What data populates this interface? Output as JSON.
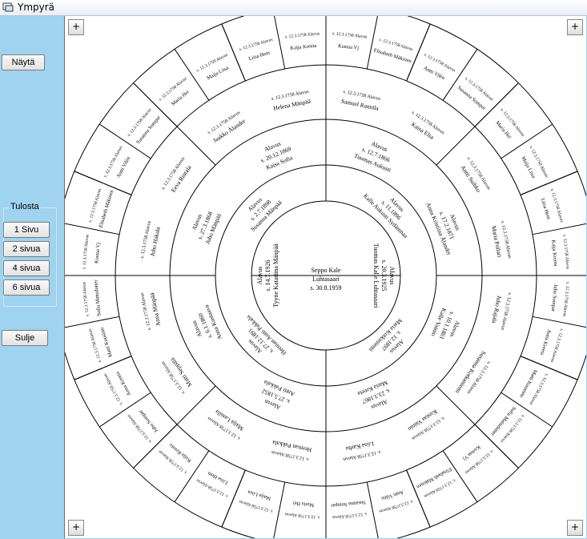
{
  "window": {
    "title": "Ympyrä"
  },
  "left_panel": {
    "show_button": "Näytä",
    "print_group": {
      "label": "Tulosta",
      "buttons": [
        "1 Sivu",
        "2 sivua",
        "4 sivua",
        "6 sivua"
      ]
    },
    "close_button": "Sulje"
  },
  "canvas": {
    "corner_buttons": [
      "+",
      "+",
      "+",
      "+"
    ],
    "center_person": {
      "name": "Seppo Kale",
      "surname": "Luhtasaari",
      "birth": "s. 30.8.1959"
    },
    "ring1": [
      "Tuomas Kalle Luhtasaari · s. 20.3.1925 · Alavus",
      "Tyyne Katariina Mänpää · s. 14.7.1926 · Alavus"
    ],
    "ring2": [
      "Kalle Aukusti Sydänmaa · s. 11.1896 · Alavus",
      "Maria Kotkaniemi · s. 12.1897 · Alavus",
      "Herman Antti Pakkala · s. 27.12.1891 · Alavus",
      "Susanna Mänpää · s. 2.7.1898 · Alavus"
    ],
    "ring3": [
      "Tuomas Aukusti · s. 12.7.1866 · Alavus",
      "Anna Kristiina Ålander · s. 17.2.1871 · Alavus",
      "Kalle Vainio · s. 10.1.1861 · Alavus",
      "Maria Kreeta · s. 23.3.1867 · Alavus",
      "Antti Pakkala · s. 27.5.1852 · Alavus",
      "Anna Kustaava · s. 6.1.1860 · Alavus",
      "Juho Mänpää · s. 27.3.1868 · Alavus",
      "Kaisa Sofia · s. 20.12.1869 · Alavus"
    ],
    "ring4": [
      "Samuel Rannila",
      "Kaisa Elsa",
      "Antti Suihko",
      "Maria Pollari",
      "Juho Rajala",
      "Susanna Kotkaniemi",
      "Kustaa Vainio",
      "Liisa Karhu",
      "Herman Pakkala",
      "Maija Lassila",
      "Matti Seppälä",
      "Anna Mänpää",
      "Juho Hakala",
      "Eeva Rintala",
      "Jaakko Ålander",
      "Helena Mänpää"
    ],
    "outer_labels": [
      "Kustaa Vj",
      "Elisabeth Mäkinen",
      "Antti Vilén",
      "Susanna Sompar",
      "Maria Hei",
      "Maija Liisa",
      "Liisa Hem",
      "Kaija Kreeta",
      "Juho Sompar",
      "Anna Kreeta",
      "Matti Kuusisto",
      "Sofia Mattsdotter"
    ],
    "scrawl_sample": "s. 12.3.1758 Alavus"
  },
  "colors": {
    "panel": "#9fd3f0",
    "canvas": "#ffffff",
    "ink": "#000000"
  }
}
